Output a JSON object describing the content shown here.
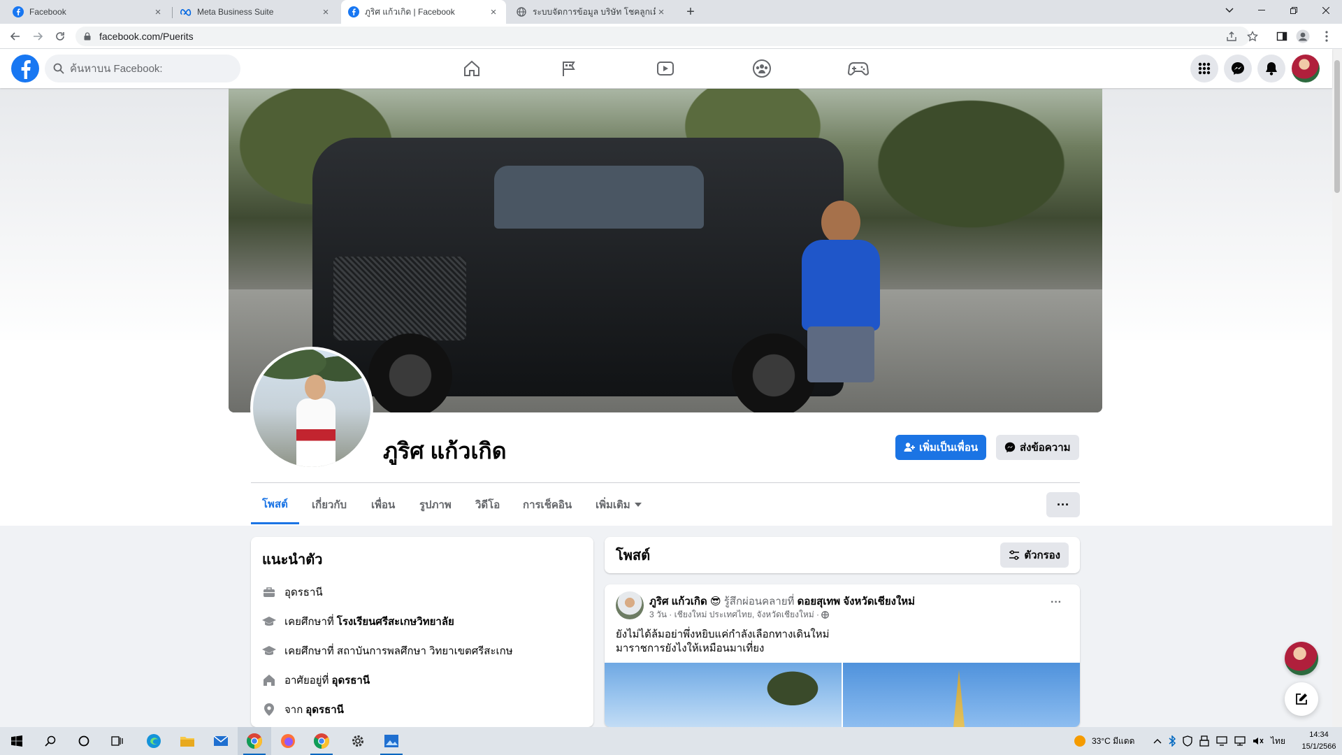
{
  "browser": {
    "tabs": [
      {
        "title": "Facebook",
        "icon": "facebook-icon"
      },
      {
        "title": "Meta Business Suite",
        "icon": "meta-icon"
      },
      {
        "title": "ภูริศ แก้วเกิด | Facebook",
        "icon": "facebook-icon",
        "active": true
      },
      {
        "title": "ระบบจัดการข้อมูล บริษัท โชคลูกเม็ด ¬",
        "icon": "globe-icon"
      }
    ],
    "url": "facebook.com/Puerits"
  },
  "fb": {
    "search_placeholder": "ค้นหาบน Facebook:",
    "nav": [
      "home-icon",
      "pages-flag-icon",
      "watch-video-icon",
      "groups-icon",
      "gaming-icon"
    ]
  },
  "profile": {
    "name": "ภูริศ แก้วเกิด",
    "add_friend": "เพิ่มเป็นเพื่อน",
    "message": "ส่งข้อความ",
    "tabs": [
      "โพสต์",
      "เกี่ยวกับ",
      "เพื่อน",
      "รูปภาพ",
      "วิดีโอ",
      "การเช็คอิน",
      "เพิ่มเติม"
    ],
    "more": "···"
  },
  "intro": {
    "title": "แนะนำตัว",
    "rows": [
      {
        "prefix": "อุดรธานี",
        "bold": ""
      },
      {
        "prefix": "เคยศึกษาที่",
        "bold": "โรงเรียนศรีสะเกษวิทยาลัย"
      },
      {
        "prefix": "เคยศึกษาที่ สถาบันการพลศึกษา วิทยาเขตศรีสะเกษ",
        "bold": ""
      },
      {
        "prefix": "อาศัยอยู่ที่",
        "bold": "อุดรธานี"
      },
      {
        "prefix": "จาก",
        "bold": "อุดรธานี"
      }
    ]
  },
  "posts": {
    "title": "โพสต์",
    "filter": "ตัวกรอง",
    "post": {
      "author": "ภูริศ แก้วเกิด",
      "emoji": "😎",
      "feeling": "รู้สึกผ่อนคลายที่",
      "place": "ดอยสุเทพ จังหวัดเชียงใหม่",
      "meta": "3 วัน · เชียงใหม่ ประเทศไทย, จังหวัดเชียงใหม่ ·",
      "text_line1": "ยังไม่ได้ล้มอย่าพึ่งหยิบแค่กำลังเลือกทางเดินใหม่",
      "text_line2": "มาราชการยังไงให้เหมือนมาเที่ยง"
    }
  },
  "taskbar": {
    "weather": "33°C มีแดด",
    "lang": "ไทย",
    "time": "14:34",
    "date": "15/1/2566"
  }
}
